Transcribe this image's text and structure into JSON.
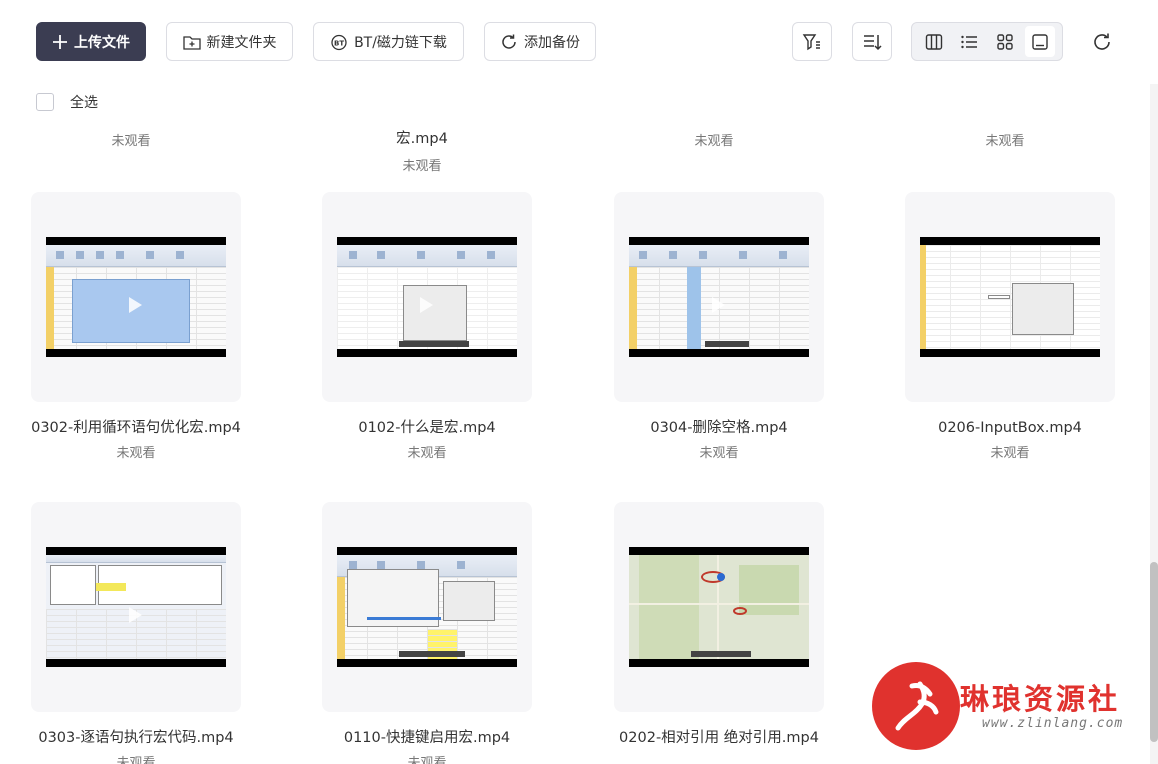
{
  "toolbar": {
    "upload_label": "上传文件",
    "new_folder_label": "新建文件夹",
    "bt_label": "BT/磁力链下载",
    "backup_label": "添加备份"
  },
  "select_all_label": "全选",
  "top_row": [
    {
      "name_tail": "宏.mp4",
      "status": "未观看"
    }
  ],
  "top_row_status": [
    "未观看",
    "未观看",
    "未观看",
    "未观看"
  ],
  "files": [
    {
      "name": "0302-利用循环语句优化宏.mp4",
      "status": "未观看"
    },
    {
      "name": "0102-什么是宏.mp4",
      "status": "未观看"
    },
    {
      "name": "0304-删除空格.mp4",
      "status": "未观看"
    },
    {
      "name": "0206-InputBox.mp4",
      "status": "未观看"
    },
    {
      "name": "0303-逐语句执行宏代码.mp4",
      "status": "未观看"
    },
    {
      "name": "0110-快捷键启用宏.mp4",
      "status": "未观看"
    },
    {
      "name": "0202-相对引用 绝对引用.mp4",
      "status": ""
    }
  ],
  "watermark": {
    "title": "琳琅资源社",
    "url": "www.zlinlang.com"
  }
}
